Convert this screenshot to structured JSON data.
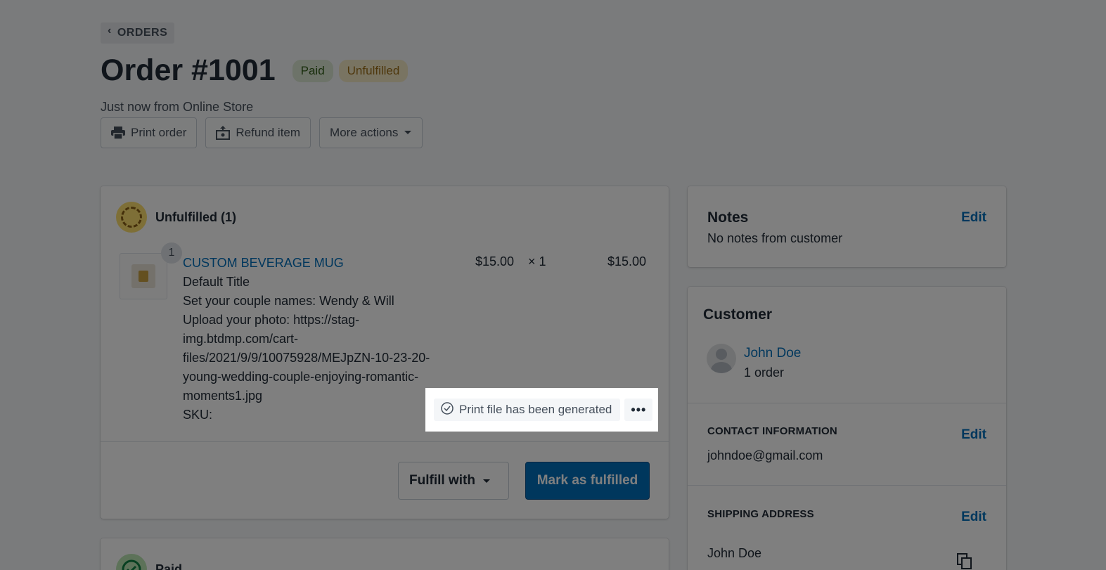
{
  "breadcrumb": {
    "label": "ORDERS"
  },
  "order": {
    "title": "Order #1001",
    "badges": {
      "paid": "Paid",
      "fulfillment": "Unfulfilled"
    },
    "subtitle": "Just now from Online Store"
  },
  "actions": {
    "print": "Print order",
    "refund": "Refund item",
    "more": "More actions"
  },
  "unfulfilled": {
    "title": "Unfulfilled (1)",
    "item": {
      "quantity_badge": "1",
      "name": "CUSTOM BEVERAGE MUG",
      "variant": "Default Title",
      "names_line": "Set your couple names: Wendy & Will",
      "photo_line": "Upload your photo: https://stag-img.btdmp.com/cart-files/2021/9/9/10075928/MEJpZN-10-23-20-young-wedding-couple-enjoying-romantic-moments1.jpg",
      "sku": "SKU:",
      "price": "$15.00",
      "times": "× 1",
      "total": "$15.00"
    },
    "print_status": "Print file has been generated",
    "more_dots": "•••",
    "fulfill_with": "Fulfill with",
    "mark_fulfilled": "Mark as fulfilled"
  },
  "paid_section": {
    "title": "Paid"
  },
  "notes": {
    "title": "Notes",
    "edit": "Edit",
    "body": "No notes from customer"
  },
  "customer": {
    "title": "Customer",
    "name": "John Doe",
    "orders": "1 order",
    "contact_heading": "CONTACT INFORMATION",
    "contact_edit": "Edit",
    "email": "johndoe@gmail.com",
    "shipping_heading": "SHIPPING ADDRESS",
    "shipping_edit": "Edit",
    "shipping_name": "John Doe"
  },
  "colors": {
    "link": "#006fbb",
    "primary_button": "#006fbb",
    "paid_badge": "#dbe6d3",
    "unfulfilled_badge": "#f3e8c4",
    "unfulfilled_icon": "#fcdf6e"
  }
}
